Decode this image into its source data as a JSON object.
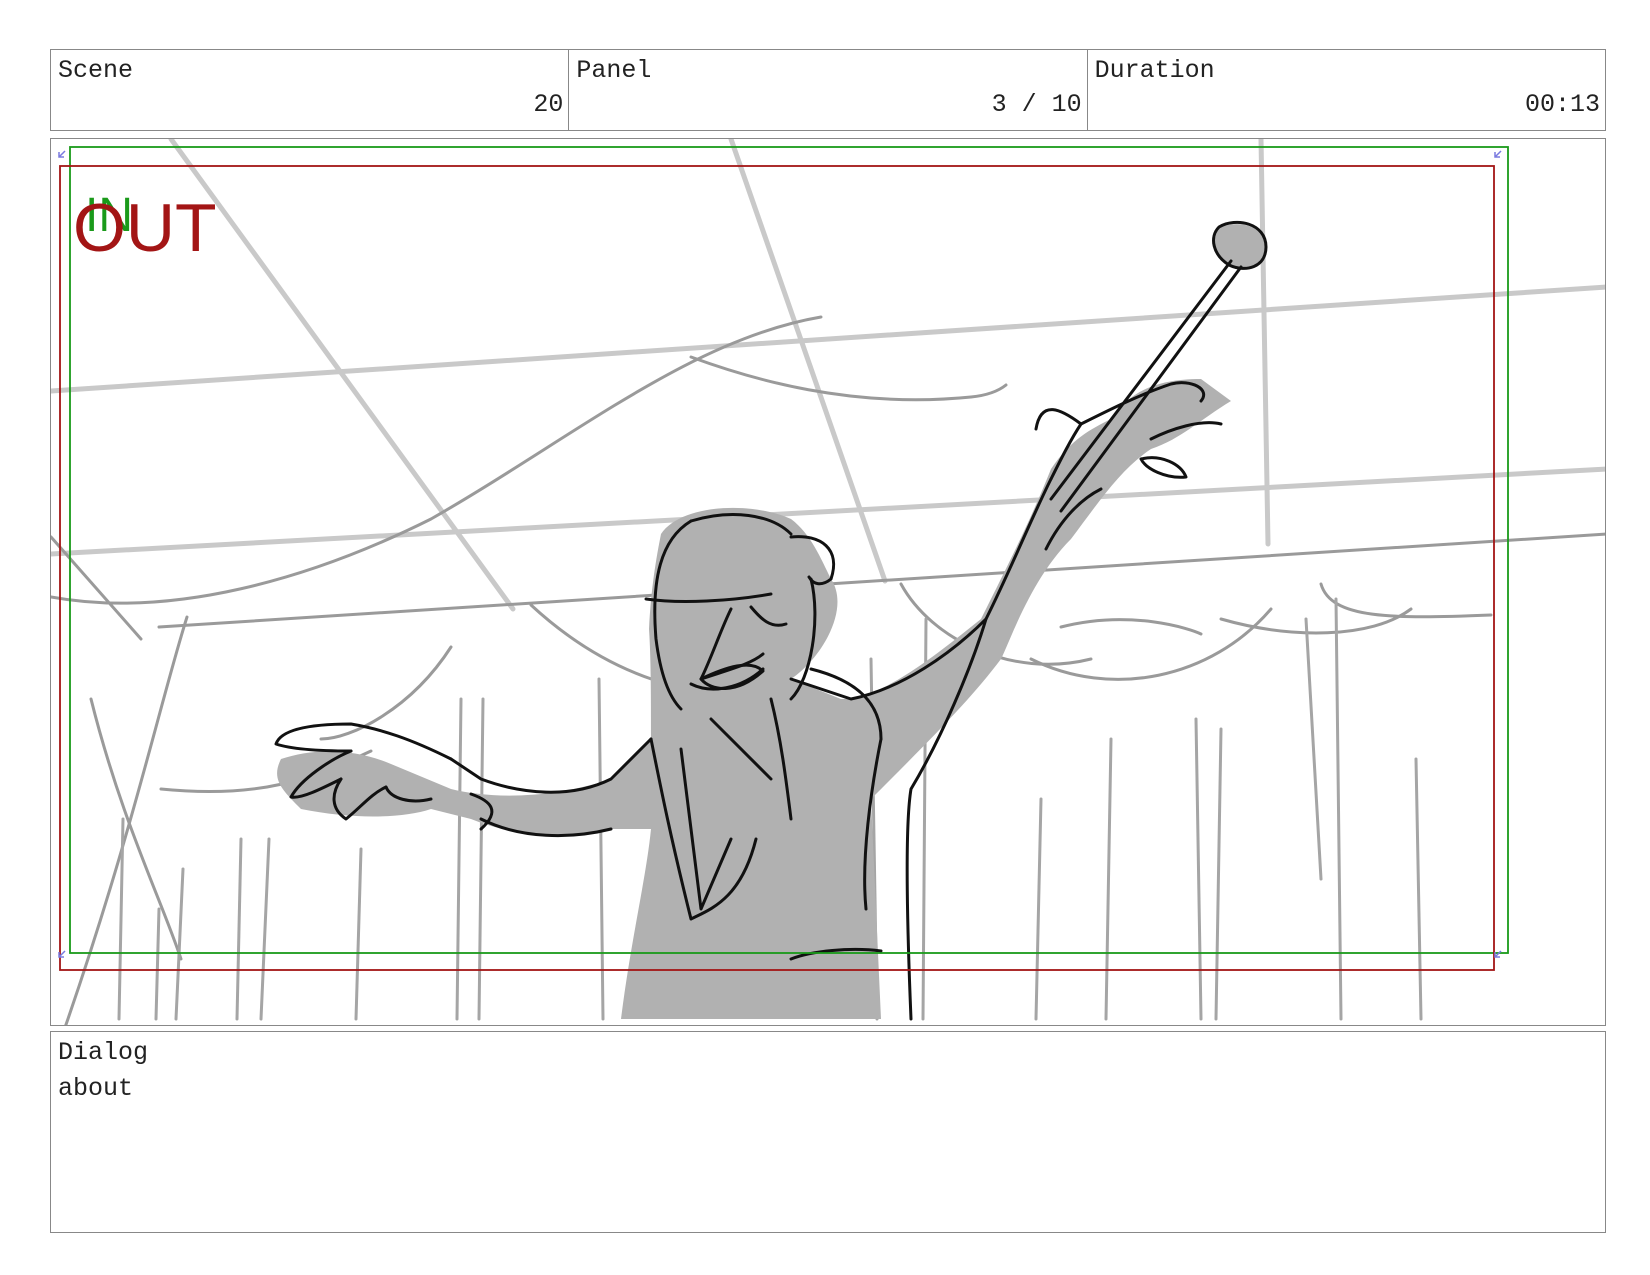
{
  "header": {
    "scene_label": "Scene",
    "scene_value": "20",
    "panel_label": "Panel",
    "panel_value": "3 / 10",
    "duration_label": "Duration",
    "duration_value": "00:13"
  },
  "frame": {
    "in_marker": "IN",
    "out_marker": "OUT",
    "in_color": "#1a9a1a",
    "out_color": "#a31515"
  },
  "dialog": {
    "label": "Dialog",
    "text": "about"
  }
}
